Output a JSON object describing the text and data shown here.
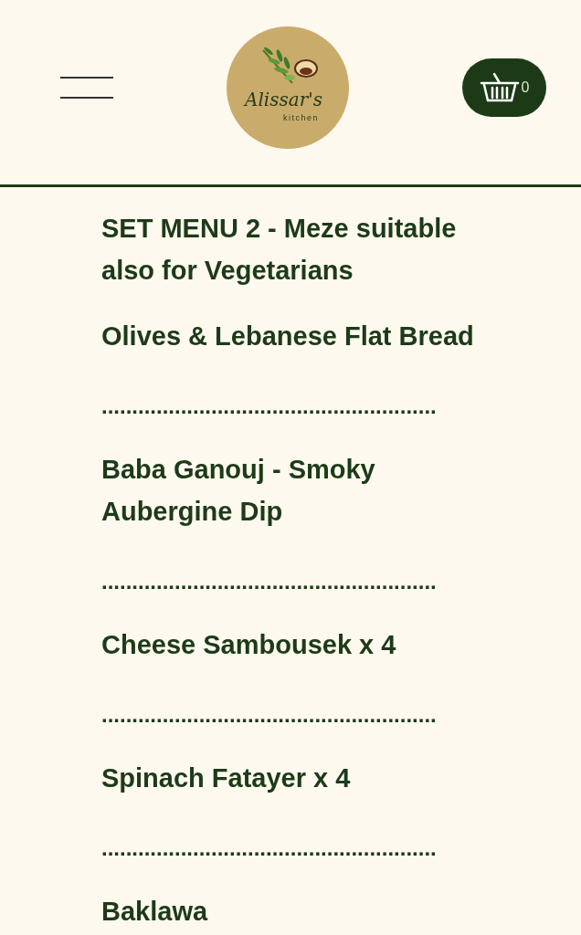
{
  "header": {
    "logo": {
      "name": "Alissar's",
      "tagline": "kitchen"
    },
    "cart": {
      "count": "0"
    }
  },
  "menu": {
    "title": "SET MENU 2 - Meze suitable also for Vegetarians",
    "items": [
      {
        "kind": "dish",
        "text": "Olives & Lebanese Flat Bread"
      },
      {
        "kind": "divider",
        "text": "......................................................."
      },
      {
        "kind": "dish",
        "text": "Baba Ganouj - Smoky Aubergine Dip"
      },
      {
        "kind": "divider",
        "text": "......................................................."
      },
      {
        "kind": "dish",
        "text": "Cheese Sambousek x 4"
      },
      {
        "kind": "divider",
        "text": "......................................................."
      },
      {
        "kind": "dish",
        "text": "Spinach Fatayer x 4"
      },
      {
        "kind": "divider",
        "text": "......................................................."
      },
      {
        "kind": "dish",
        "text": "Baklawa"
      }
    ]
  }
}
